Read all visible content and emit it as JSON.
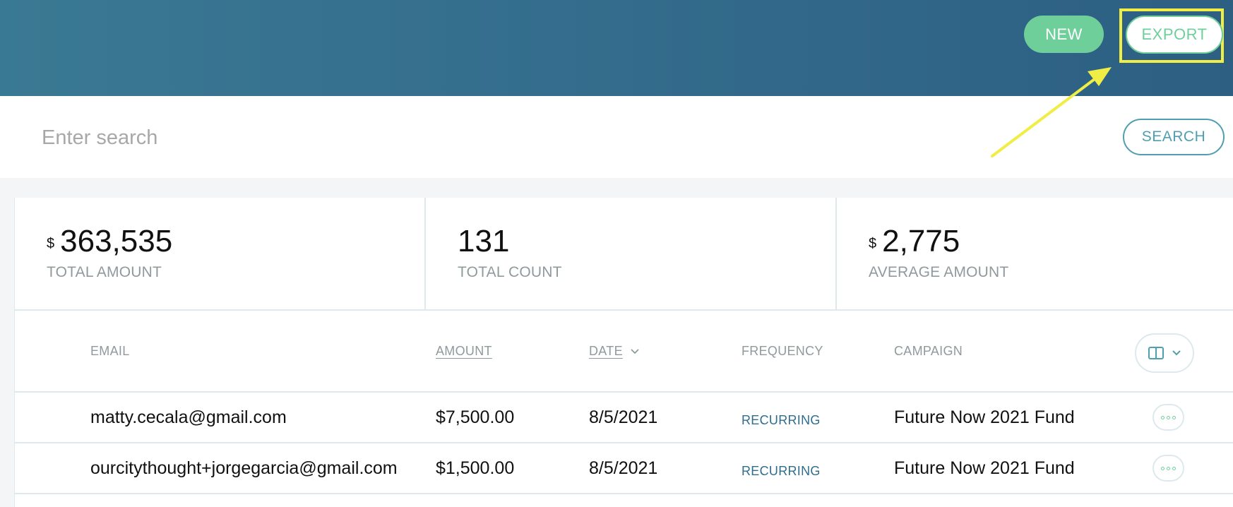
{
  "header": {
    "new_label": "NEW",
    "export_label": "EXPORT"
  },
  "search": {
    "placeholder": "Enter search",
    "button_label": "SEARCH"
  },
  "stats": [
    {
      "currency": "$",
      "value": "363,535",
      "label": "TOTAL AMOUNT"
    },
    {
      "currency": "",
      "value": "131",
      "label": "TOTAL COUNT"
    },
    {
      "currency": "$",
      "value": "2,775",
      "label": "AVERAGE AMOUNT"
    }
  ],
  "table": {
    "columns": {
      "email": "EMAIL",
      "amount": "AMOUNT",
      "date": "DATE",
      "frequency": "FREQUENCY",
      "campaign": "CAMPAIGN"
    },
    "rows": [
      {
        "email": "matty.cecala@gmail.com",
        "amount": "$7,500.00",
        "date": "8/5/2021",
        "frequency": "RECURRING",
        "campaign": "Future Now 2021 Fund"
      },
      {
        "email": "ourcitythought+jorgegarcia@gmail.com",
        "amount": "$1,500.00",
        "date": "8/5/2021",
        "frequency": "RECURRING",
        "campaign": "Future Now 2021 Fund"
      }
    ]
  },
  "colors": {
    "header_start": "#3a7993",
    "header_end": "#2d5f82",
    "accent_green": "#6fcf9b",
    "highlight_yellow": "#f0ee45",
    "frequency_text": "#2f6d8d"
  },
  "icons": {
    "column_picker": "columns-icon",
    "column_picker_caret": "chevron-down-icon",
    "row_actions": "more-horizontal-icon",
    "sort_indicator": "chevron-down-icon"
  }
}
